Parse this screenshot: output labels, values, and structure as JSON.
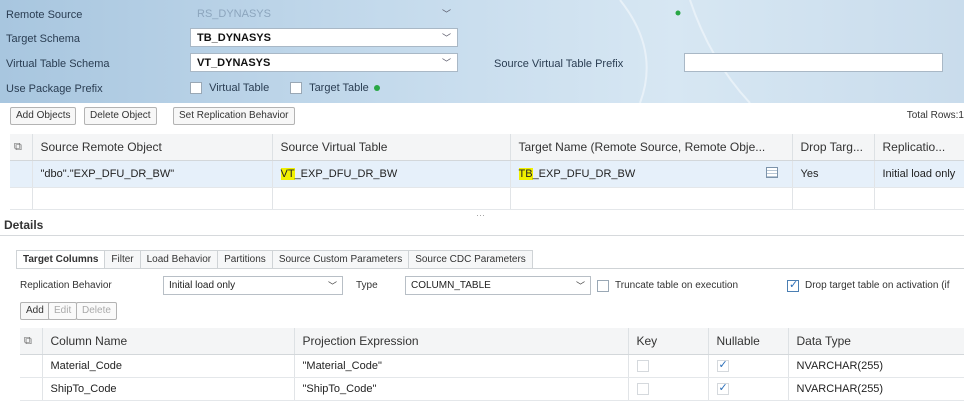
{
  "form": {
    "remote_source_label": "Remote Source",
    "remote_source_value": "RS_DYNASYS",
    "target_schema_label": "Target Schema",
    "target_schema_value": "TB_DYNASYS",
    "virtual_table_schema_label": "Virtual Table Schema",
    "virtual_table_schema_value": "VT_DYNASYS",
    "source_virtual_table_prefix_label": "Source Virtual Table Prefix",
    "source_virtual_table_prefix_value": "",
    "use_package_prefix_label": "Use Package Prefix",
    "virtual_table_label": "Virtual Table",
    "target_table_label": "Target Table"
  },
  "toolbar": {
    "add_objects": "Add Objects",
    "delete_object": "Delete Object",
    "set_replication_behavior": "Set Replication Behavior",
    "total_rows": "Total Rows:1"
  },
  "objects_table": {
    "headers": [
      "Source Remote Object",
      "Source Virtual Table",
      "Target Name (Remote Source, Remote Obje...",
      "Drop Targ...",
      "Replicatio..."
    ],
    "rows": [
      {
        "source_remote_object": "\"dbo\".\"EXP_DFU_DR_BW\"",
        "vt_prefix": "VT",
        "vt_rest": "_EXP_DFU_DR_BW",
        "tb_prefix": "TB",
        "tb_rest": "_EXP_DFU_DR_BW",
        "drop_target": "Yes",
        "replication": "Initial load only"
      }
    ]
  },
  "details": {
    "title": "Details",
    "tabs": [
      "Target Columns",
      "Filter",
      "Load Behavior",
      "Partitions",
      "Source Custom Parameters",
      "Source CDC Parameters"
    ],
    "replication_behavior_label": "Replication Behavior",
    "replication_behavior_value": "Initial load only",
    "type_label": "Type",
    "type_value": "COLUMN_TABLE",
    "truncate_label": "Truncate table on execution",
    "drop_label": "Drop target table on activation (if",
    "add": "Add",
    "edit": "Edit",
    "delete": "Delete"
  },
  "columns_table": {
    "headers": [
      "Column Name",
      "Projection Expression",
      "Key",
      "Nullable",
      "Data Type"
    ],
    "rows": [
      {
        "name": "Material_Code",
        "expr": "\"Material_Code\"",
        "key": false,
        "nullable": true,
        "type": "NVARCHAR(255)"
      },
      {
        "name": "ShipTo_Code",
        "expr": "\"ShipTo_Code\"",
        "key": false,
        "nullable": true,
        "type": "NVARCHAR(255)"
      }
    ]
  }
}
